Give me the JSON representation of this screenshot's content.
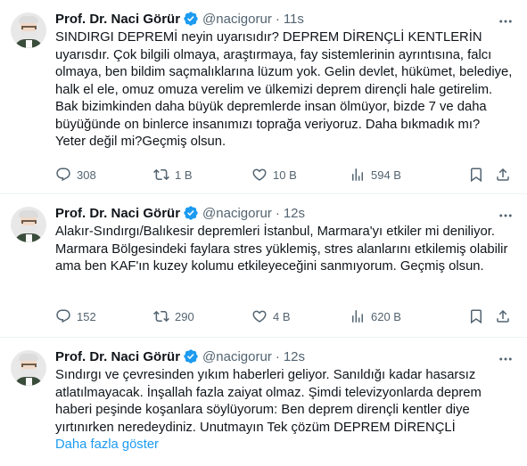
{
  "tweets": [
    {
      "author_name": "Prof. Dr. Naci Görür",
      "handle": "@nacigorur",
      "time": "11s",
      "text": "SINDIRGI DEPREMİ neyin uyarısıdır? DEPREM DİRENÇLİ KENTLERİN uyarısdır. Çok bilgili olmaya, araştırmaya, fay sistemlerinin ayrıntısına, falcı olmaya, ben bildim saçmalıklarına lüzum yok. Gelin devlet, hükümet, belediye, halk el ele, omuz omuza verelim ve ülkemizi deprem dirençli hale getirelim. Bak bizimkinden daha büyük depremlerde insan ölmüyor, bizde 7 ve daha büyüğünde on binlerce insanımızı toprağa veriyoruz. Daha bıkmadık mı? Yeter değil mi?Geçmiş olsun.",
      "replies": "308",
      "retweets": "1 B",
      "likes": "10 B",
      "views": "594 B"
    },
    {
      "author_name": "Prof. Dr. Naci Görür",
      "handle": "@nacigorur",
      "time": "12s",
      "text": "Alakır-Sındırgı/Balıkesir depremleri İstanbul, Marmara'yı etkiler mi deniliyor. Marmara Bölgesindeki faylara stres yüklemiş, stres alanlarını etkilemiş olabilir ama ben KAF'ın kuzey kolumu etkileyeceğini sanmıyorum. Geçmiş olsun.",
      "replies": "152",
      "retweets": "290",
      "likes": "4 B",
      "views": "620 B"
    },
    {
      "author_name": "Prof. Dr. Naci Görür",
      "handle": "@nacigorur",
      "time": "12s",
      "text": "Sındırgı ve çevresinden yıkım haberleri geliyor. Sanıldığı kadar hasarsız atlatılmayacak. İnşallah fazla zaiyat olmaz. Şimdi televizyonlarda deprem haberi peşinde koşanlara söylüyorum: Ben deprem dirençli kentler diye yırtınırken neredeydiniz. Unutmayın Tek çözüm DEPREM DİRENÇLİ",
      "show_more": "Daha fazla göster"
    }
  ],
  "icons": {
    "verified": "verified-badge-icon",
    "more": "more-dots-icon",
    "reply": "reply-icon",
    "retweet": "retweet-icon",
    "like": "heart-icon",
    "views": "views-chart-icon",
    "bookmark": "bookmark-icon",
    "share": "share-icon"
  },
  "colors": {
    "verified": "#1d9bf0",
    "link": "#1d9bf0",
    "muted": "#536471",
    "text": "#0f1419"
  }
}
